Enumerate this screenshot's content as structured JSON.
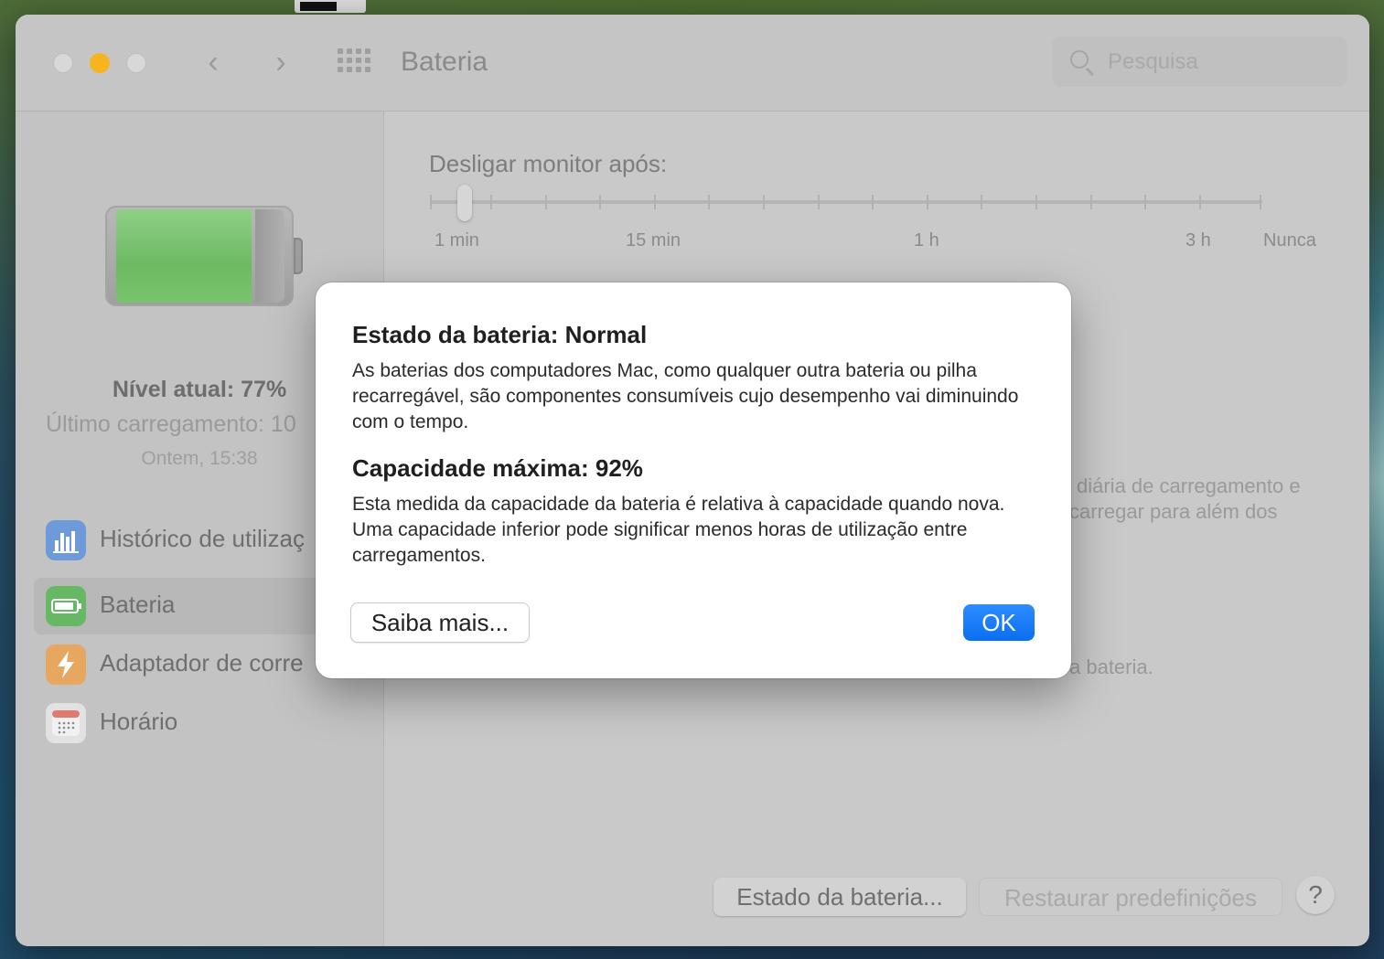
{
  "window": {
    "title": "Bateria",
    "search_placeholder": "Pesquisa"
  },
  "sidebar": {
    "level": "Nível atual: 77%",
    "last_charge": "Último carregamento: 10",
    "last_charge_time": "Ontem, 15:38",
    "items": [
      {
        "label": "Histórico de utilizaç",
        "icon": "bar-chart-icon",
        "color": "#5d8ed6"
      },
      {
        "label": "Bateria",
        "icon": "battery-icon",
        "color": "#5cb85c"
      },
      {
        "label": "Adaptador de corre",
        "icon": "lightning-icon",
        "color": "#e8a85a"
      },
      {
        "label": "Horário",
        "icon": "calendar-icon",
        "color": "#e8e8e8"
      }
    ]
  },
  "main": {
    "slider_title": "Desligar monitor após:",
    "slider_value_fraction": 0.04,
    "slider_labels": [
      "1 min",
      "15 min",
      "1 h",
      "3 h",
      "Nunca"
    ],
    "bg_text_1": "diária de carregamento e",
    "bg_text_2": "carregar para além dos",
    "bg_text_3": "a bateria.",
    "btn_estado": "Estado da bateria...",
    "btn_restaurar": "Restaurar predefinições",
    "btn_help": "?"
  },
  "dialog": {
    "heading_1": "Estado da bateria: Normal",
    "para_1": "As baterias dos computadores Mac, como qualquer outra bateria ou pilha recarregável, são componentes consumíveis cujo desempenho vai diminuindo com o tempo.",
    "heading_2": "Capacidade máxima: 92%",
    "para_2": "Esta medida da capacidade da bateria é relativa à capacidade quando nova. Uma capacidade inferior pode significar menos horas de utilização entre carregamentos.",
    "btn_more": "Saiba mais...",
    "btn_ok": "OK"
  }
}
